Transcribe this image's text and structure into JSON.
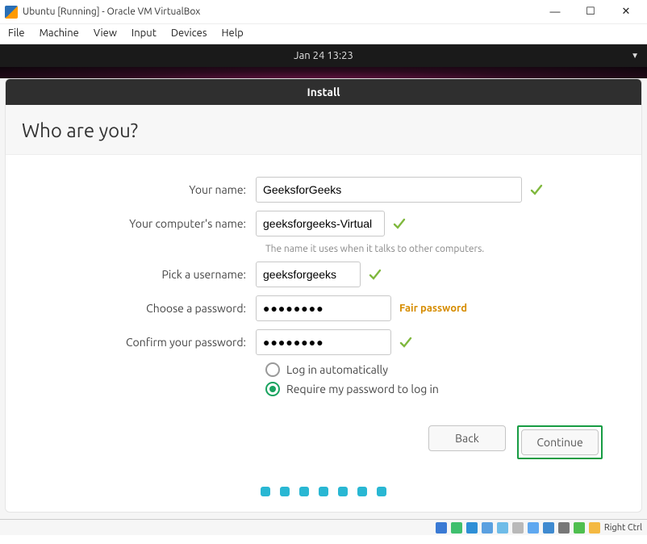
{
  "window": {
    "title": "Ubuntu [Running] - Oracle VM VirtualBox",
    "controls": {
      "min": "—",
      "max": "☐",
      "close": "✕"
    }
  },
  "menubar": [
    "File",
    "Machine",
    "View",
    "Input",
    "Devices",
    "Help"
  ],
  "gnome": {
    "clock": "Jan 24  13:23"
  },
  "installer": {
    "header": "Install",
    "title": "Who are you?",
    "labels": {
      "name": "Your name:",
      "host": "Your computer's name:",
      "hint_host": "The name it uses when it talks to other computers.",
      "user": "Pick a username:",
      "pw": "Choose a password:",
      "pw2": "Confirm your password:",
      "auto": "Log in automatically",
      "req": "Require my password to log in"
    },
    "values": {
      "name": "GeeksforGeeks",
      "host": "geeksforgeeks-Virtual",
      "user": "geeksforgeeks",
      "pw": "●●●●●●●●",
      "pw2": "●●●●●●●●",
      "strength": "Fair password"
    },
    "buttons": {
      "back": "Back",
      "continue": "Continue"
    }
  },
  "statusbar": {
    "hostkey": "Right Ctrl"
  }
}
